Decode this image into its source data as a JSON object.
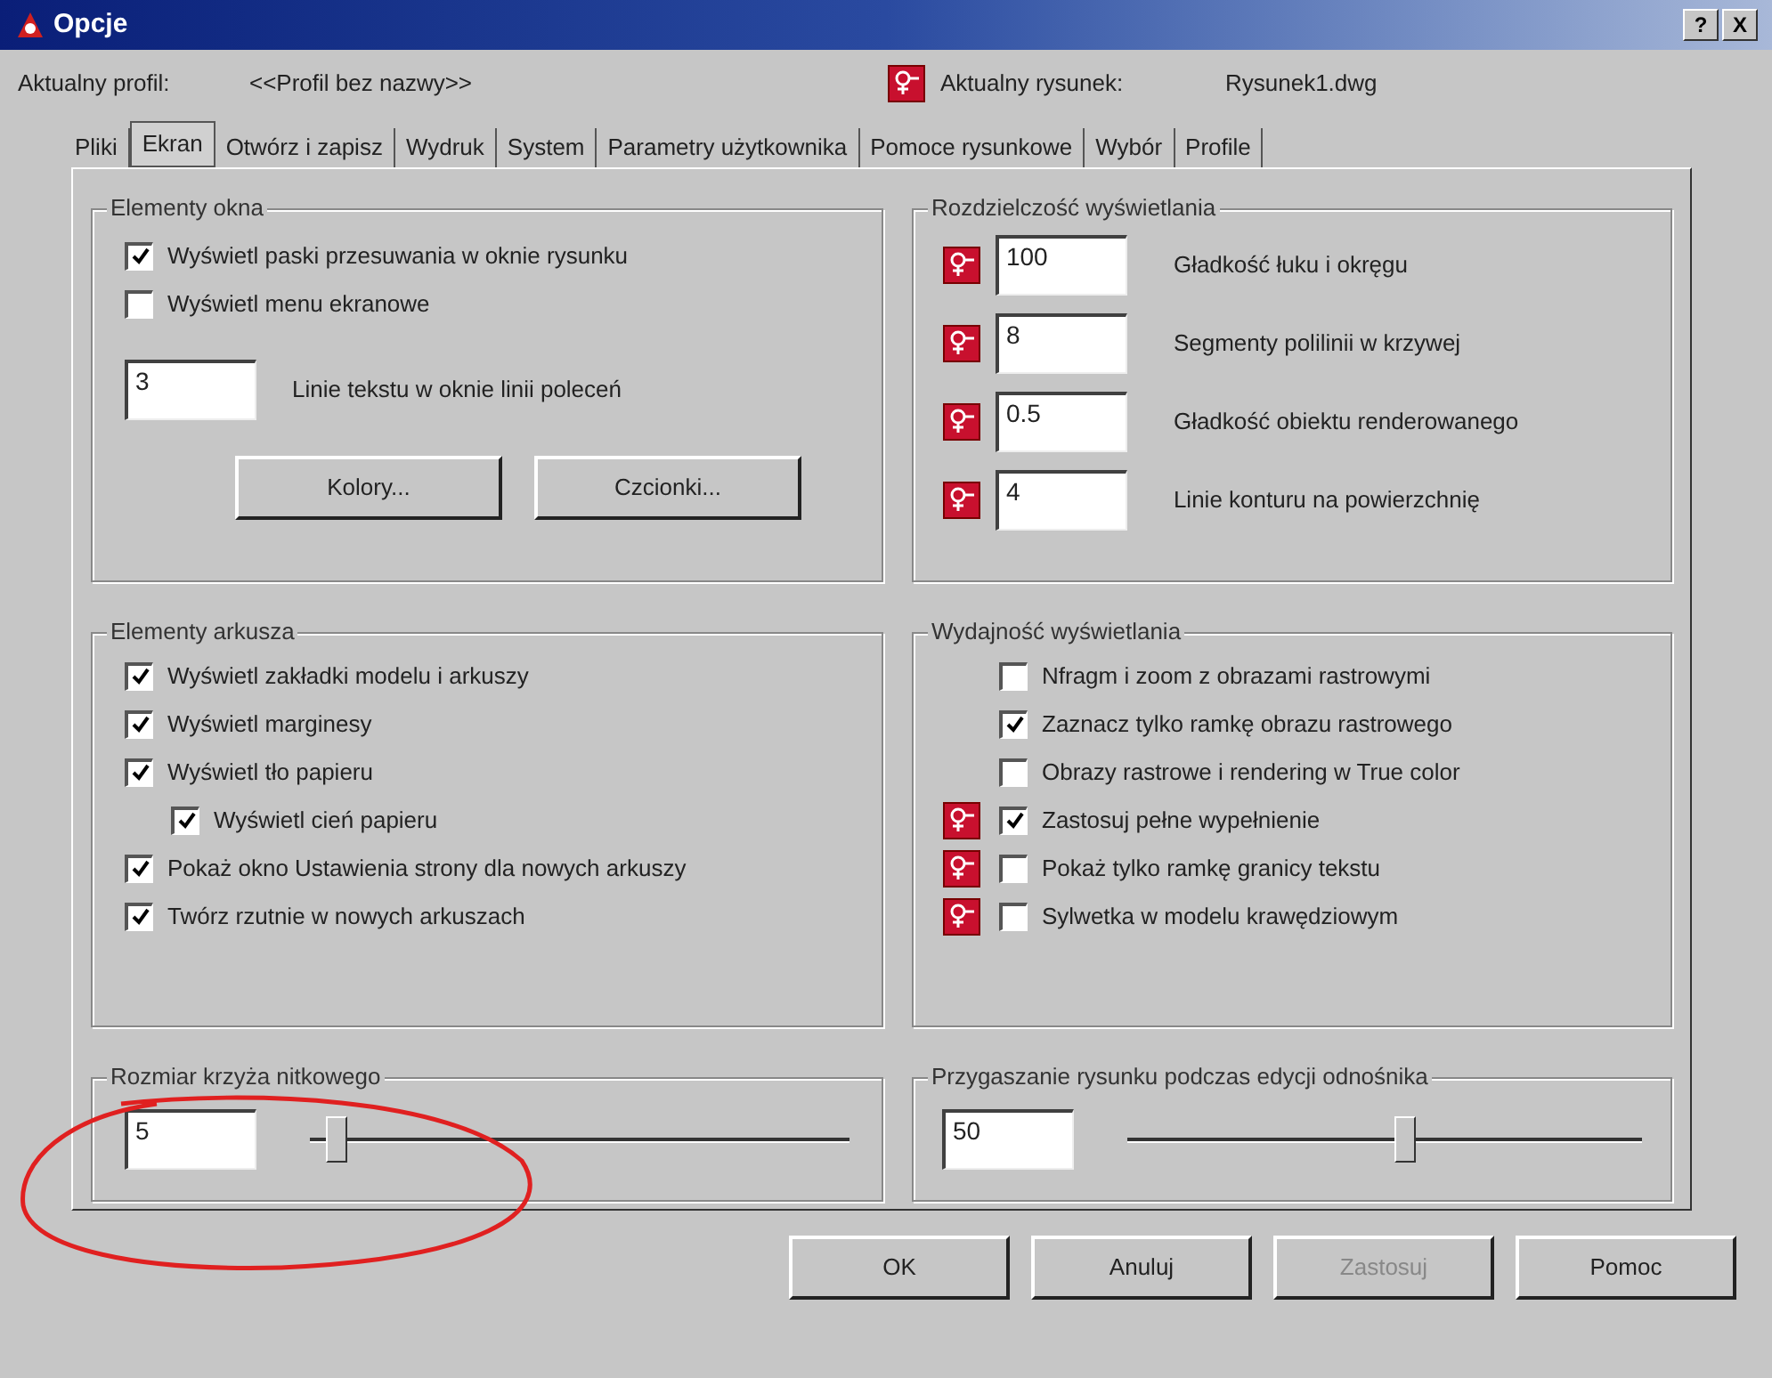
{
  "window": {
    "title": "Opcje",
    "help_button": "?",
    "close_button": "X"
  },
  "profile": {
    "label": "Aktualny profil:",
    "value": "<<Profil bez nazwy>>"
  },
  "drawing": {
    "label": "Aktualny rysunek:",
    "value": "Rysunek1.dwg"
  },
  "tabs": [
    {
      "label": "Pliki",
      "selected": false
    },
    {
      "label": "Ekran",
      "selected": true
    },
    {
      "label": "Otwórz i zapisz",
      "selected": false
    },
    {
      "label": "Wydruk",
      "selected": false
    },
    {
      "label": "System",
      "selected": false
    },
    {
      "label": "Parametry użytkownika",
      "selected": false
    },
    {
      "label": "Pomoce rysunkowe",
      "selected": false
    },
    {
      "label": "Wybór",
      "selected": false
    },
    {
      "label": "Profile",
      "selected": false
    }
  ],
  "window_elements": {
    "title": "Elementy okna",
    "checkboxes": [
      {
        "label": "Wyświetl paski przesuwania w oknie rysunku",
        "checked": true
      },
      {
        "label": "Wyświetl menu ekranowe",
        "checked": false
      }
    ],
    "field": {
      "value": "3",
      "label": "Linie tekstu w oknie linii poleceń"
    },
    "buttons": [
      "Kolory...",
      "Czcionki..."
    ]
  },
  "resolution": {
    "title": "Rozdzielczość wyświetlania",
    "rows": [
      {
        "value": "100",
        "label": "Gładkość łuku i okręgu"
      },
      {
        "value": "8",
        "label": "Segmenty polilinii w krzywej"
      },
      {
        "value": "0.5",
        "label": "Gładkość obiektu renderowanego"
      },
      {
        "value": "4",
        "label": "Linie konturu na powierzchnię"
      }
    ]
  },
  "layout_elements": {
    "title": "Elementy arkusza",
    "checkboxes": [
      {
        "label": "Wyświetl zakładki modelu i arkuszy",
        "checked": true
      },
      {
        "label": "Wyświetl marginesy",
        "checked": true
      },
      {
        "label": "Wyświetl tło papieru",
        "checked": true,
        "children": [
          {
            "label": "Wyświetl cień papieru",
            "checked": true
          }
        ]
      },
      {
        "label": "Pokaż okno Ustawienia strony dla nowych arkuszy",
        "checked": true
      },
      {
        "label": "Twórz rzutnie w nowych arkuszach",
        "checked": true
      }
    ]
  },
  "performance": {
    "title": "Wydajność wyświetlania",
    "checkboxes": [
      {
        "label": "Nfragm i zoom z obrazami rastrowymi",
        "checked": false,
        "flagged": false
      },
      {
        "label": "Zaznacz tylko ramkę obrazu rastrowego",
        "checked": true,
        "flagged": false
      },
      {
        "label": "Obrazy rastrowe i rendering w True color",
        "checked": false,
        "flagged": false
      },
      {
        "label": "Zastosuj pełne wypełnienie",
        "checked": true,
        "flagged": true
      },
      {
        "label": "Pokaż tylko ramkę granicy tekstu",
        "checked": false,
        "flagged": true
      },
      {
        "label": "Sylwetka w modelu krawędziowym",
        "checked": false,
        "flagged": true
      }
    ]
  },
  "crosshair_size": {
    "title": "Rozmiar krzyża nitkowego",
    "value": "5",
    "level": 0.05
  },
  "xref_fade": {
    "title": "Przygaszanie rysunku podczas edycji odnośnika",
    "value": "50",
    "level": 0.54
  },
  "buttons": [
    {
      "label": "OK",
      "disabled": false
    },
    {
      "label": "Anuluj",
      "disabled": false
    },
    {
      "label": "Zastosuj",
      "disabled": true
    },
    {
      "label": "Pomoc",
      "disabled": false
    }
  ]
}
